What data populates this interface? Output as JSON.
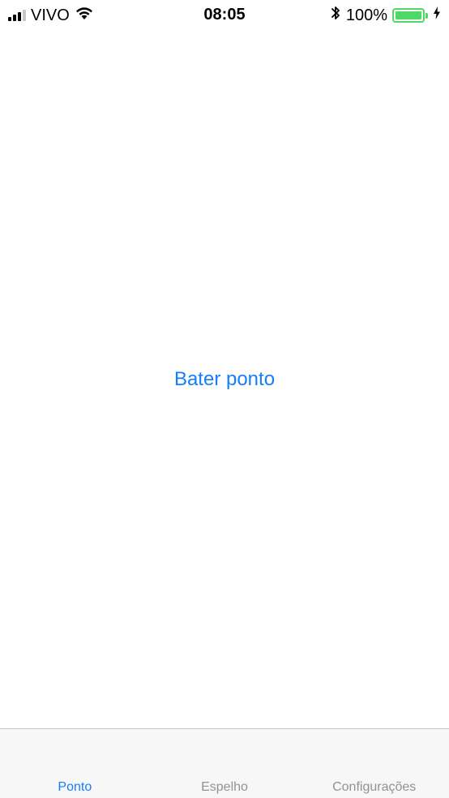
{
  "status_bar": {
    "carrier": "VIVO",
    "time": "08:05",
    "battery_percent": "100%",
    "battery_level": 1.0,
    "signal_bars": 3,
    "signal_bars_max": 4
  },
  "main": {
    "punch_button_label": "Bater ponto"
  },
  "tab_bar": {
    "tabs": [
      {
        "label": "Ponto",
        "active": true
      },
      {
        "label": "Espelho",
        "active": false
      },
      {
        "label": "Configurações",
        "active": false
      }
    ]
  },
  "colors": {
    "accent": "#147efb",
    "inactive_tab": "#929292",
    "battery": "#4cd964",
    "tab_bar_background": "#f7f7f7"
  }
}
